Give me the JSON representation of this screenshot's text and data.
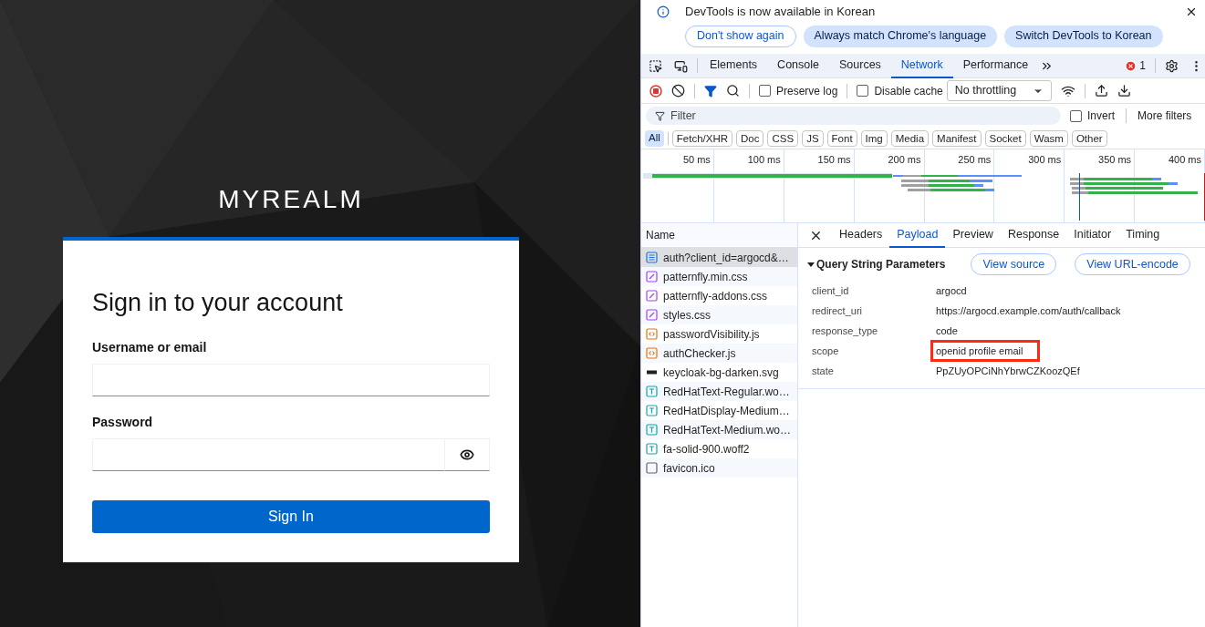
{
  "login": {
    "realm": "MYREALM",
    "title": "Sign in to your account",
    "fields": [
      {
        "label": "Username or email",
        "kind": "text"
      },
      {
        "label": "Password",
        "kind": "password"
      }
    ],
    "submit": "Sign In"
  },
  "devtools": {
    "infobar": {
      "message": "DevTools is now available in Korean",
      "buttons": [
        {
          "label": "Don't show again",
          "kind": "outline"
        },
        {
          "label": "Always match Chrome's language",
          "kind": "filled"
        },
        {
          "label": "Switch DevTools to Korean",
          "kind": "filled"
        }
      ]
    },
    "panel_tabs": [
      {
        "label": "Elements",
        "selected": false
      },
      {
        "label": "Console",
        "selected": false
      },
      {
        "label": "Sources",
        "selected": false
      },
      {
        "label": "Network",
        "selected": true
      },
      {
        "label": "Performance",
        "selected": false
      }
    ],
    "error_count": "1",
    "toolbar": {
      "preserve_log": {
        "label": "Preserve log",
        "checked": false
      },
      "disable_cache": {
        "label": "Disable cache",
        "checked": false
      },
      "throttling": "No throttling"
    },
    "filter": {
      "placeholder": "Filter",
      "invert": {
        "label": "Invert",
        "checked": false
      },
      "more": "More filters"
    },
    "type_filters": [
      {
        "label": "All",
        "selected": true
      },
      {
        "label": "Fetch/XHR",
        "selected": false
      },
      {
        "label": "Doc",
        "selected": false
      },
      {
        "label": "CSS",
        "selected": false
      },
      {
        "label": "JS",
        "selected": false
      },
      {
        "label": "Font",
        "selected": false
      },
      {
        "label": "Img",
        "selected": false
      },
      {
        "label": "Media",
        "selected": false
      },
      {
        "label": "Manifest",
        "selected": false
      },
      {
        "label": "Socket",
        "selected": false
      },
      {
        "label": "Wasm",
        "selected": false
      },
      {
        "label": "Other",
        "selected": false
      }
    ],
    "timeline_ticks": [
      "50 ms",
      "100 ms",
      "150 ms",
      "200 ms",
      "250 ms",
      "300 ms",
      "350 ms",
      "400 ms"
    ],
    "name_header": "Name",
    "requests": [
      {
        "name": "auth?client_id=argocd&…",
        "kind": "doc",
        "selected": true
      },
      {
        "name": "patternfly.min.css",
        "kind": "css",
        "selected": false
      },
      {
        "name": "patternfly-addons.css",
        "kind": "css",
        "selected": false
      },
      {
        "name": "styles.css",
        "kind": "css",
        "selected": false
      },
      {
        "name": "passwordVisibility.js",
        "kind": "js",
        "selected": false
      },
      {
        "name": "authChecker.js",
        "kind": "js",
        "selected": false
      },
      {
        "name": "keycloak-bg-darken.svg",
        "kind": "img",
        "selected": false
      },
      {
        "name": "RedHatText-Regular.wo…",
        "kind": "font",
        "selected": false
      },
      {
        "name": "RedHatDisplay-Medium…",
        "kind": "font",
        "selected": false
      },
      {
        "name": "RedHatText-Medium.wo…",
        "kind": "font",
        "selected": false
      },
      {
        "name": "fa-solid-900.woff2",
        "kind": "font",
        "selected": false
      },
      {
        "name": "favicon.ico",
        "kind": "other",
        "selected": false
      }
    ],
    "detail_tabs": [
      {
        "label": "Headers",
        "selected": false
      },
      {
        "label": "Payload",
        "selected": true
      },
      {
        "label": "Preview",
        "selected": false
      },
      {
        "label": "Response",
        "selected": false
      },
      {
        "label": "Initiator",
        "selected": false
      },
      {
        "label": "Timing",
        "selected": false
      }
    ],
    "section": {
      "title": "Query String Parameters",
      "expanded": true,
      "buttons": [
        "View source",
        "View URL-encode"
      ]
    },
    "params": [
      {
        "key": "client_id",
        "value": "argocd",
        "highlighted": false
      },
      {
        "key": "redirect_uri",
        "value": "https://argocd.example.com/auth/callback",
        "highlighted": false
      },
      {
        "key": "response_type",
        "value": "code",
        "highlighted": false
      },
      {
        "key": "scope",
        "value": "openid profile email",
        "highlighted": true
      },
      {
        "key": "state",
        "value": "PpZUyOPCiNhYbrwCZKoozQEf",
        "highlighted": false
      }
    ]
  }
}
